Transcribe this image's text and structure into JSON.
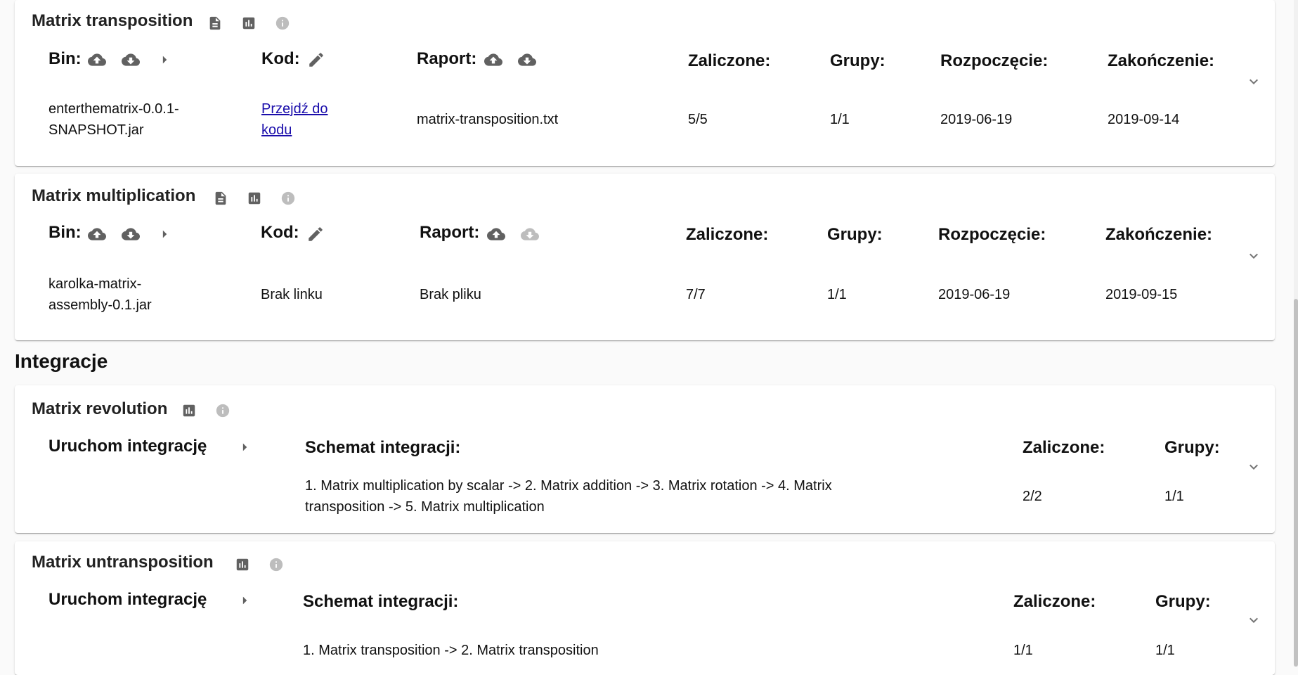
{
  "assignments": [
    {
      "title": "Matrix transposition",
      "headers": {
        "bin": "Bin:",
        "code": "Kod:",
        "report": "Raport:",
        "passed": "Zaliczone:",
        "groups": "Grupy:",
        "start": "Rozpoczęcie:",
        "end": "Zakończenie:"
      },
      "bin": "enterthematrix-0.0.1-SNAPSHOT.jar",
      "code": "Przejdź do kodu",
      "code_is_link": true,
      "report": "matrix-transposition.txt",
      "report_download_enabled": true,
      "passed": "5/5",
      "groups": "1/1",
      "start": "2019-06-19",
      "end": "2019-09-14"
    },
    {
      "title": "Matrix multiplication",
      "headers": {
        "bin": "Bin:",
        "code": "Kod:",
        "report": "Raport:",
        "passed": "Zaliczone:",
        "groups": "Grupy:",
        "start": "Rozpoczęcie:",
        "end": "Zakończenie:"
      },
      "bin": "karolka-matrix-assembly-0.1.jar",
      "code": "Brak linku",
      "code_is_link": false,
      "report": "Brak pliku",
      "report_download_enabled": false,
      "passed": "7/7",
      "groups": "1/1",
      "start": "2019-06-19",
      "end": "2019-09-15"
    }
  ],
  "integrations_title": "Integracje",
  "integrations": [
    {
      "title": "Matrix revolution",
      "run_label": "Uruchom integrację",
      "scheme_header": "Schemat integracji:",
      "passed_header": "Zaliczone:",
      "groups_header": "Grupy:",
      "scheme": "1. Matrix multiplication by scalar -> 2. Matrix addition -> 3. Matrix rotation -> 4. Matrix transposition -> 5. Matrix multiplication",
      "passed": "2/2",
      "groups": "1/1"
    },
    {
      "title": "Matrix untransposition",
      "run_label": "Uruchom integrację",
      "scheme_header": "Schemat integracji:",
      "passed_header": "Zaliczone:",
      "groups_header": "Grupy:",
      "scheme": "1. Matrix transposition -> 2. Matrix transposition",
      "passed": "1/1",
      "groups": "1/1"
    }
  ],
  "icons": {
    "upload": "cloud-upload-icon",
    "download": "cloud-download-icon",
    "play": "play-icon",
    "edit": "pencil-icon",
    "doc": "document-icon",
    "stats": "bar-chart-icon",
    "info": "info-icon",
    "expand": "chevron-down-icon"
  },
  "colors": {
    "link": "#1a0dab",
    "icon": "#616161",
    "icon_disabled": "#bdbdbd",
    "info": "#9e9e9e"
  }
}
